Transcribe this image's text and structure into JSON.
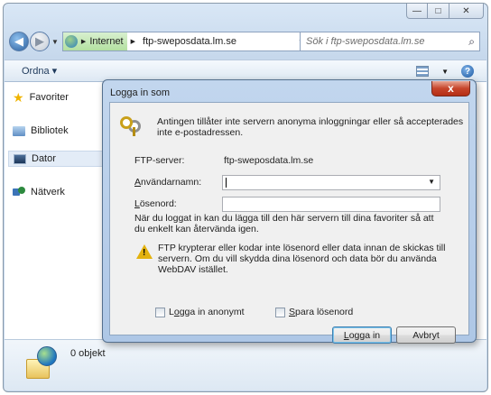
{
  "window": {
    "caption_buttons": [
      "—",
      "□",
      "✕"
    ]
  },
  "nav": {
    "breadcrumbs": [
      "Internet",
      "ftp-sweposdata.lm.se"
    ],
    "search_placeholder": "Sök i ftp-sweposdata.lm.se"
  },
  "toolbar": {
    "organize_label": "Ordna ▾",
    "help_label": "?"
  },
  "sidebar": {
    "items": [
      {
        "label": "Favoriter",
        "icon": "star-icon"
      },
      {
        "label": "Bibliotek",
        "icon": "library-icon"
      },
      {
        "label": "Dator",
        "icon": "computer-icon"
      },
      {
        "label": "Nätverk",
        "icon": "network-icon"
      }
    ]
  },
  "details": {
    "count_text": "0 objekt"
  },
  "dialog": {
    "title": "Logga in som",
    "close_label": "x",
    "intro": "Antingen tillåter inte servern anonyma inloggningar eller så accepterades inte e-postadressen.",
    "server_label": "FTP-server:",
    "server_value": "ftp-sweposdata.lm.se",
    "username_label_u": "A",
    "username_label_rest": "nvändarnamn:",
    "username_value": "",
    "password_label_u": "L",
    "password_label_rest": "ösenord:",
    "info": "När du loggat in kan du lägga till den här servern till dina favoriter så att du enkelt kan återvända igen.",
    "warning": "FTP krypterar eller kodar inte lösenord eller data innan de skickas till servern. Om du vill skydda dina lösenord och data bör du använda WebDAV istället.",
    "anon_u": "o",
    "anon_pre": "L",
    "anon_rest": "gga in anonymt",
    "save_u": "S",
    "save_rest": "para lösenord",
    "login_u": "L",
    "login_rest": "ogga in",
    "cancel_label": "Avbryt"
  }
}
